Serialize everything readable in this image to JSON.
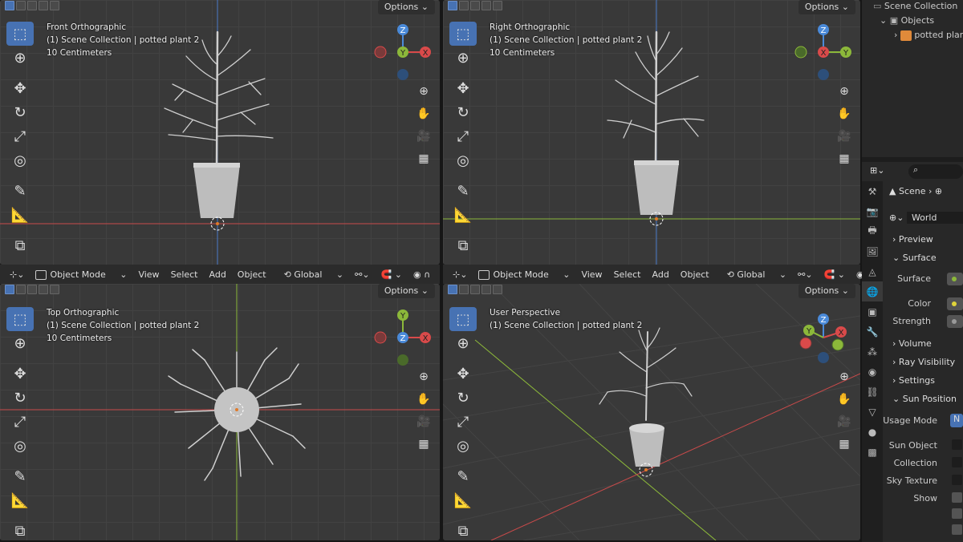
{
  "viewports": [
    {
      "id": "front",
      "title": "Front Orthographic",
      "collection": "(1) Scene Collection | potted plant 2",
      "scale": "10 Centimeters",
      "options": "Options"
    },
    {
      "id": "right",
      "title": "Right Orthographic",
      "collection": "(1) Scene Collection | potted plant 2",
      "scale": "10 Centimeters",
      "options": "Options"
    },
    {
      "id": "top",
      "title": "Top Orthographic",
      "collection": "(1) Scene Collection | potted plant 2",
      "scale": "10 Centimeters",
      "options": "Options"
    },
    {
      "id": "persp",
      "title": "User Perspective",
      "collection": "(1) Scene Collection | potted plant 2",
      "options": "Options"
    }
  ],
  "header_bar": {
    "mode": "Object Mode",
    "view": "View",
    "select": "Select",
    "add": "Add",
    "object": "Object",
    "orientation": "Global"
  },
  "gizmo": {
    "x": "X",
    "y": "Y",
    "z": "Z"
  },
  "outliner": {
    "scene_collection": "Scene Collection",
    "objects": "Objects",
    "item": "potted plan"
  },
  "properties": {
    "scene_label": "Scene",
    "world_name": "World",
    "preview": "Preview",
    "surface_panel": "Surface",
    "surface_label": "Surface",
    "color_label": "Color",
    "strength_label": "Strength",
    "volume": "Volume",
    "ray_visibility": "Ray Visibility",
    "settings": "Settings",
    "sun_position": "Sun Position",
    "usage_mode_label": "Usage Mode",
    "usage_mode_value": "N",
    "sun_object_label": "Sun Object",
    "collection_label": "Collection",
    "sky_texture_label": "Sky Texture",
    "show_label": "Show"
  },
  "colors": {
    "x_axis": "#d94a4a",
    "y_axis": "#8cb83a",
    "z_axis": "#4a8ad9",
    "active": "#4772b3"
  }
}
